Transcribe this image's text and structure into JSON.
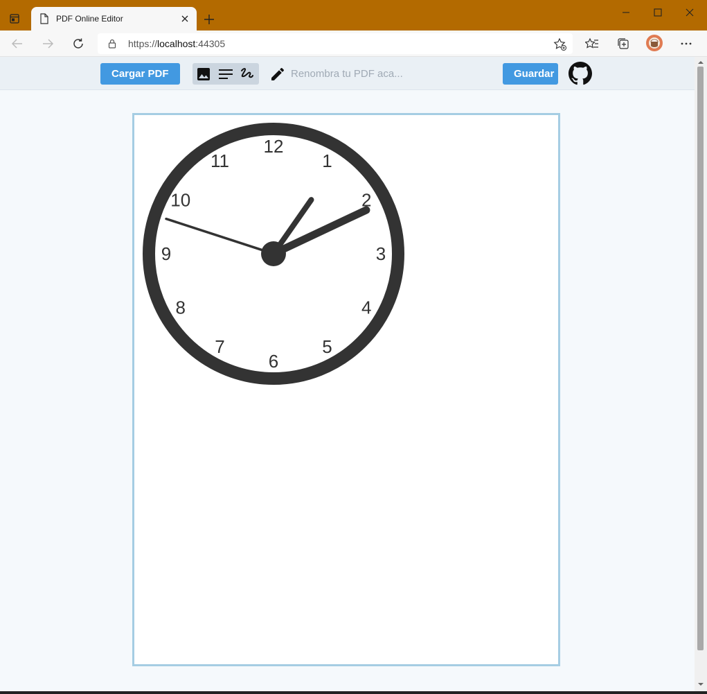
{
  "browser": {
    "tab_title": "PDF Online Editor",
    "url_scheme": "https://",
    "url_host": "localhost",
    "url_port": ":44305"
  },
  "toolbar": {
    "load_button": "Cargar PDF",
    "rename_placeholder": "Renombra tu PDF aca...",
    "rename_value": "",
    "save_button": "Guardar",
    "tools": [
      "image-icon",
      "text-icon",
      "draw-icon"
    ]
  },
  "clock": {
    "numbers": [
      "12",
      "1",
      "2",
      "3",
      "4",
      "5",
      "6",
      "7",
      "8",
      "9",
      "10",
      "11"
    ],
    "hour": 1,
    "minute": 10,
    "second": 48
  },
  "colors": {
    "accent": "#4299e1",
    "chrome": "#b36a00",
    "clock": "#333333"
  }
}
